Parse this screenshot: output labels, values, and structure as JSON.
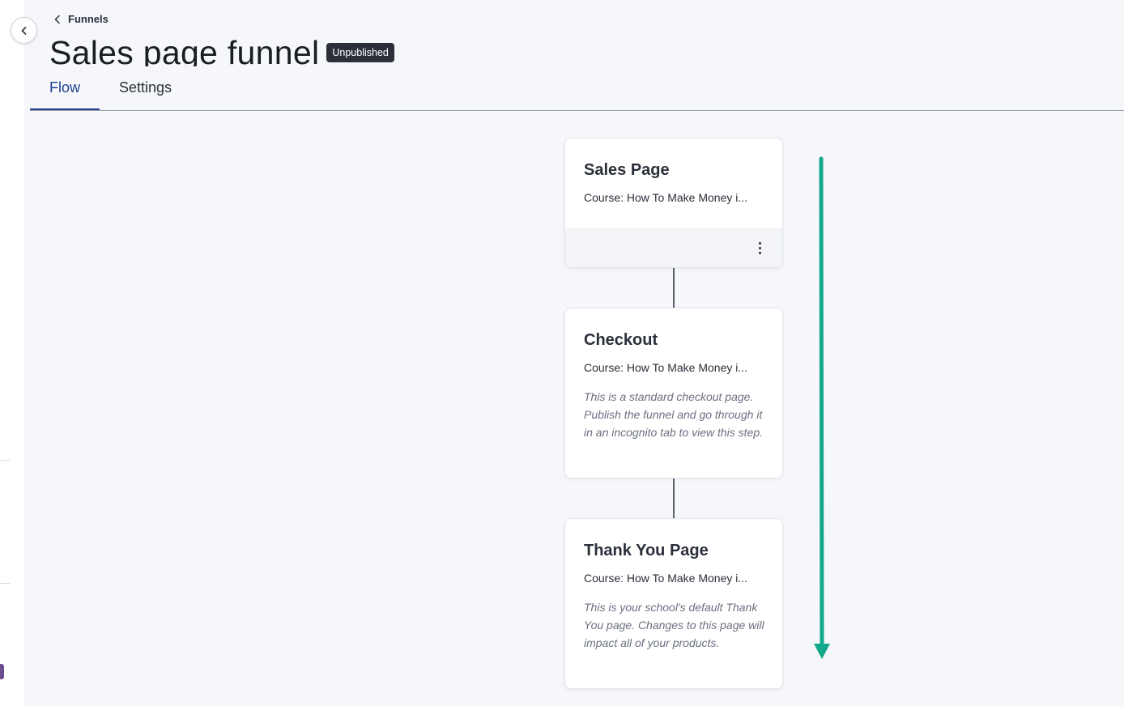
{
  "header": {
    "back_label": "Funnels",
    "title": "Sales page funnel",
    "status_badge": "Unpublished"
  },
  "tabs": [
    {
      "label": "Flow",
      "active": true
    },
    {
      "label": "Settings",
      "active": false
    }
  ],
  "flow_steps": [
    {
      "title": "Sales Page",
      "subtitle": "Course: How To Make Money i...",
      "description": ""
    },
    {
      "title": "Checkout",
      "subtitle": "Course: How To Make Money i...",
      "description": "This is a standard checkout page. Publish the funnel and go through it in an incognito tab to view this step."
    },
    {
      "title": "Thank You Page",
      "subtitle": "Course: How To Make Money i...",
      "description": "This is your school's default Thank You page. Changes to this page will impact all of your products."
    }
  ],
  "colors": {
    "accent": "#1f3f8f",
    "badge_bg": "#2b2f3a",
    "annotation_arrow": "#13a88a",
    "rail_marker": "#6b4f8f"
  },
  "icons": {
    "collapse": "chevron-left-icon",
    "back": "chevron-left-icon",
    "card_menu": "more-vertical-icon",
    "annotation": "arrow-down-icon"
  }
}
